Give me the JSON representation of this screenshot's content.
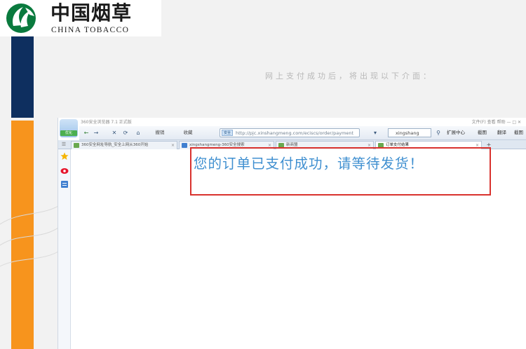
{
  "logo": {
    "chinese": "中国烟草",
    "english": "CHINA TOBACCO",
    "brand_color": "#0a7a3e"
  },
  "caption": "网上支付成功后，将出现以下介面：",
  "browser": {
    "title": "360安全浏览器 7.1 正式版",
    "window_controls": "文件(F)  查看  帮助  —  □  ✕",
    "badge": "优化",
    "toolbar": {
      "back": "←",
      "forward": "→",
      "stop": "✕",
      "refresh": "⟳",
      "home": "⌂",
      "undo": "撤销",
      "favorites": "收藏",
      "url_tag": "安全",
      "url": "http://pjc.xinshangmeng.com/eciscs/order/payment",
      "search": "xingshang",
      "ext1": "扩展中心",
      "ext2": "截图",
      "ext3": "翻译",
      "ext4": "截图"
    },
    "tabs": [
      {
        "label": "360安全网址导航_安全上网从360开始",
        "active": false
      },
      {
        "label": "xingshangmeng-360安全搜索",
        "active": false
      },
      {
        "label": "新商盟",
        "active": false
      },
      {
        "label": "订单支付结果",
        "active": true
      }
    ],
    "new_tab": "+"
  },
  "message": "您的订单已支付成功，请等待发货！",
  "colors": {
    "navy_bar": "#0e2f5f",
    "orange_bar": "#f7941d",
    "highlight": "#d9322e",
    "message": "#3f8fd0"
  }
}
